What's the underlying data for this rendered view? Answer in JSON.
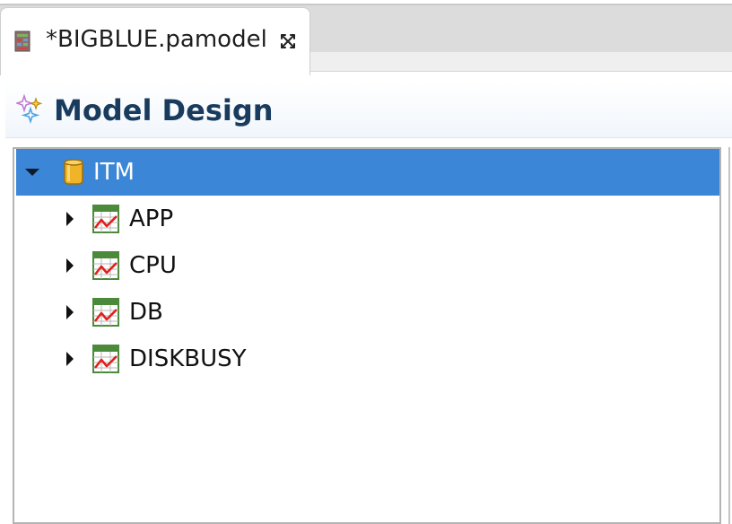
{
  "tab": {
    "title": "*BIGBLUE.pamodel",
    "icon": "model-file-icon",
    "close_icon": "close-icon"
  },
  "header": {
    "title": "Model Design",
    "icon": "sparkles-icon"
  },
  "tree": {
    "root": {
      "label": "ITM",
      "icon": "database-icon",
      "expanded": true,
      "selected": true
    },
    "children": [
      {
        "label": "APP",
        "icon": "chart-table-icon",
        "expanded": false
      },
      {
        "label": "CPU",
        "icon": "chart-table-icon",
        "expanded": false
      },
      {
        "label": "DB",
        "icon": "chart-table-icon",
        "expanded": false
      },
      {
        "label": "DISKBUSY",
        "icon": "chart-table-icon",
        "expanded": false
      }
    ]
  },
  "colors": {
    "selection": "#3b86d6",
    "header_text": "#193c5e",
    "table_icon_green": "#4b8a3a",
    "chart_line_red": "#e0201c",
    "database_gold": "#f0b429"
  }
}
